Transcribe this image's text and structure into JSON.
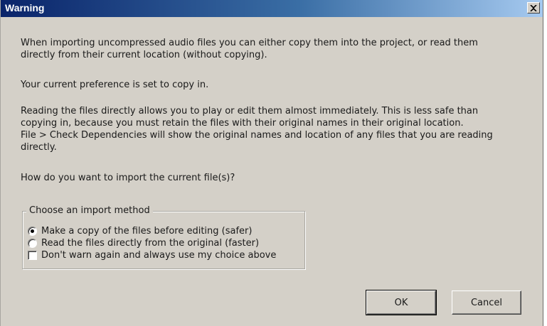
{
  "dialog": {
    "title": "Warning",
    "close_glyph": "x",
    "paragraphs": {
      "p1_line1": "When importing uncompressed audio files you can either copy them into the project, or read them",
      "p1_line2": "directly from their current location (without copying).",
      "p2": "Your current preference is set to copy in.",
      "p3_line1": "Reading the files directly allows you to play or edit them almost immediately.  This is less safe than",
      "p3_line2": "copying in, because you must retain the files with their original names in their original location.",
      "p3_line3": "File > Check Dependencies will show the original names and location of any files that you are reading",
      "p3_line4": "directly.",
      "p4": "How do you want to import the current file(s)?"
    },
    "group": {
      "legend": "Choose an import method",
      "option_copy": "Make a copy of the files before editing (safer)",
      "option_read": "Read the files directly from the original (faster)",
      "dont_warn": "Don't warn again and always use my choice above",
      "selected": "copy",
      "dont_warn_checked": false
    },
    "buttons": {
      "ok": "OK",
      "cancel": "Cancel"
    }
  },
  "colors": {
    "dialog_bg": "#d4d0c8",
    "title_start": "#0a246a",
    "title_end": "#a6caf0"
  },
  "icons": {
    "close": "close-icon"
  }
}
